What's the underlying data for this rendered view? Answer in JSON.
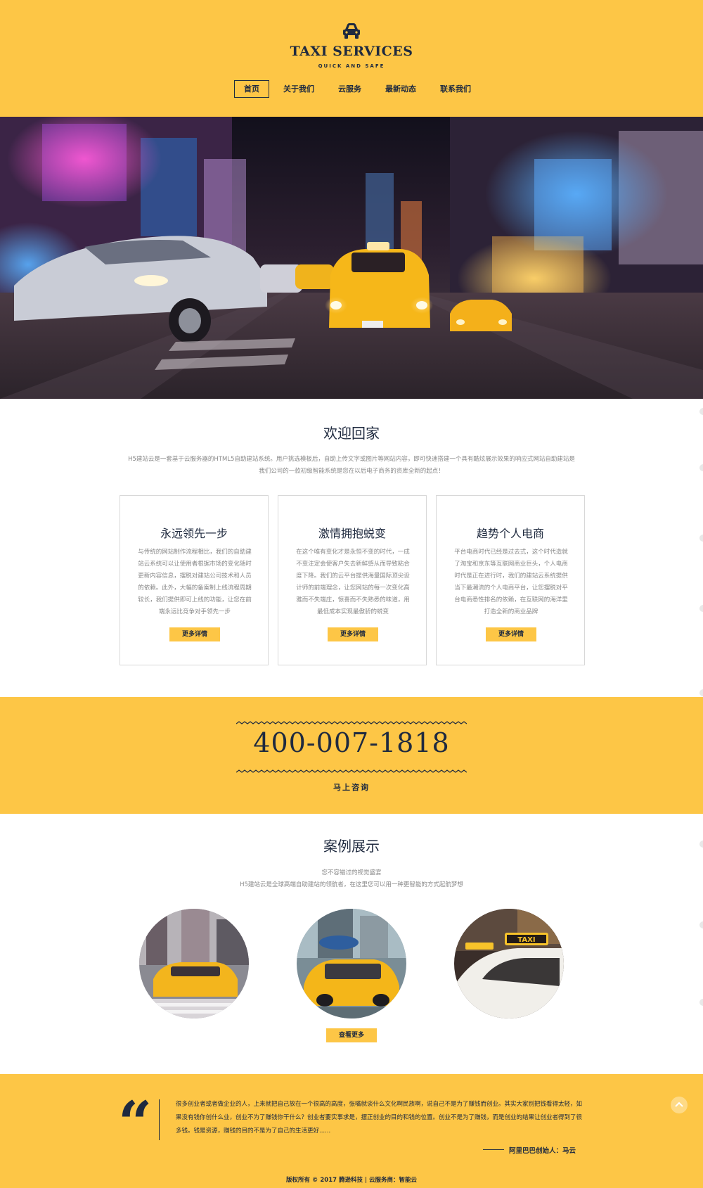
{
  "header": {
    "title": "TAXI SERVICES",
    "subtitle": "QUICK AND SAFE",
    "logo_icon": "taxi-car-icon",
    "nav": [
      {
        "label": "首页",
        "active": true
      },
      {
        "label": "关于我们",
        "active": false
      },
      {
        "label": "云服务",
        "active": false
      },
      {
        "label": "最新动态",
        "active": false
      },
      {
        "label": "联系我们",
        "active": false
      }
    ]
  },
  "welcome": {
    "title": "欢迎回家",
    "description": "H5建站云是一套基于云服务器的HTML5自助建站系统。用户挑选模板后，自助上传文字或图片等网站内容，即可快速搭建一个具有酷炫展示效果的响应式网站自助建站是我们公司的一款初级智能系统是您在以后电子商务的资库全新的起点！",
    "cards": [
      {
        "title": "永远领先一步",
        "text": "与传统的网站制作流程相比，我们的自助建站云系统可以让使用者根据市场的变化随时更新内容信息，摆脱对建站公司技术和人员的依赖。此外，大幅的备案制上线流程周期较长，我们提供即可上线的功能，让您在前端永远比竞争对手领先一步",
        "button": "更多详情"
      },
      {
        "title": "激情拥抱蜕变",
        "text": "在这个唯有变化才是永恒不变的时代，一成不变注定会使客户失去新鲜感从而导致粘合度下降。我们的云平台提供海量国际顶尖设计师的前端理念，让您网站的每一次变化高雅而不失端庄，惊喜而不失熟悉的味道，用最低成本实现最傲骄的蜕变",
        "button": "更多详情"
      },
      {
        "title": "趋势个人电商",
        "text": "平台电商时代已经是过去式，这个时代造就了淘宝和京东等互联网商业巨头，个人电商时代是正在进行时，我们的建站云系统提供当下最潮流的个人电商平台，让您摆脱对平台电商悉性排名的依赖，在互联网的海洋里打造全新的商业品牌",
        "button": "更多详情"
      }
    ]
  },
  "phone": {
    "number": "400-007-1818",
    "cta": "马上咨询"
  },
  "cases": {
    "title": "案例展示",
    "subtitle1": "您不容错过的视觉盛宴",
    "subtitle2": "H5建站云是全球高端自助建站的领航者，在这里您可以用一种更智能的方式起航梦想",
    "more_button": "查看更多"
  },
  "footer": {
    "quote": "很多创业者或者做企业的人，上来就把自己放在一个很高的高度，张嘴就谈什么文化啊民族啊，说自己不是为了赚钱而创业。其实大家别把钱看得太轻，如果没有钱你创什么业，创业不为了赚钱你干什么？创业者要实事求是，摆正创业的目的和钱的位置。创业不是为了赚钱，而是创业的结果让创业者得到了很多钱。钱是资源，赚钱的目的不是为了自己的生活更好......",
    "author": "阿里巴巴创始人：马云",
    "copyright": "版权所有 © 2017 腾逊科技 | 云服务商：智能云"
  },
  "colors": {
    "brand_yellow": "#fdc646",
    "navy": "#1f2a3f",
    "muted_text": "#888888"
  }
}
